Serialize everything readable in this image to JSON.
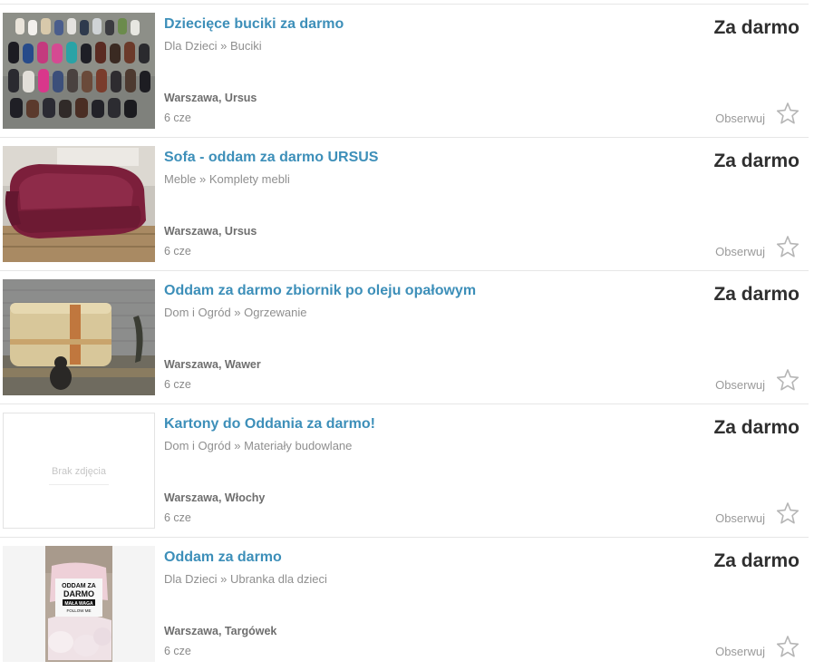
{
  "listings": [
    {
      "title": "Dziecięce buciki za darmo",
      "category": "Dla Dzieci » Buciki",
      "location": "Warszawa, Ursus",
      "date": "6 cze",
      "price": "Za darmo",
      "watch_label": "Obserwuj",
      "photo": "shoes-photo"
    },
    {
      "title": "Sofa - oddam za darmo URSUS",
      "category": "Meble » Komplety mebli",
      "location": "Warszawa, Ursus",
      "date": "6 cze",
      "price": "Za darmo",
      "watch_label": "Obserwuj",
      "photo": "sofa-photo"
    },
    {
      "title": "Oddam za darmo zbiornik po oleju opałowym",
      "category": "Dom i Ogród » Ogrzewanie",
      "location": "Warszawa, Wawer",
      "date": "6 cze",
      "price": "Za darmo",
      "watch_label": "Obserwuj",
      "photo": "oil-tank-photo"
    },
    {
      "title": "Kartony do Oddania za darmo!",
      "category": "Dom i Ogród » Materiały budowlane",
      "location": "Warszawa, Włochy",
      "date": "6 cze",
      "price": "Za darmo",
      "watch_label": "Obserwuj",
      "no_photo_label": "Brak zdjęcia"
    },
    {
      "title": "Oddam za darmo",
      "category": "Dla Dzieci » Ubranka dla dzieci",
      "location": "Warszawa, Targówek",
      "date": "6 cze",
      "price": "Za darmo",
      "watch_label": "Obserwuj",
      "photo": "baby-clothes-photo",
      "photo_sign_text": [
        "ODDAM ZA",
        "DARMO",
        "MAŁA WAGA",
        "FOLLOW ME"
      ]
    }
  ]
}
